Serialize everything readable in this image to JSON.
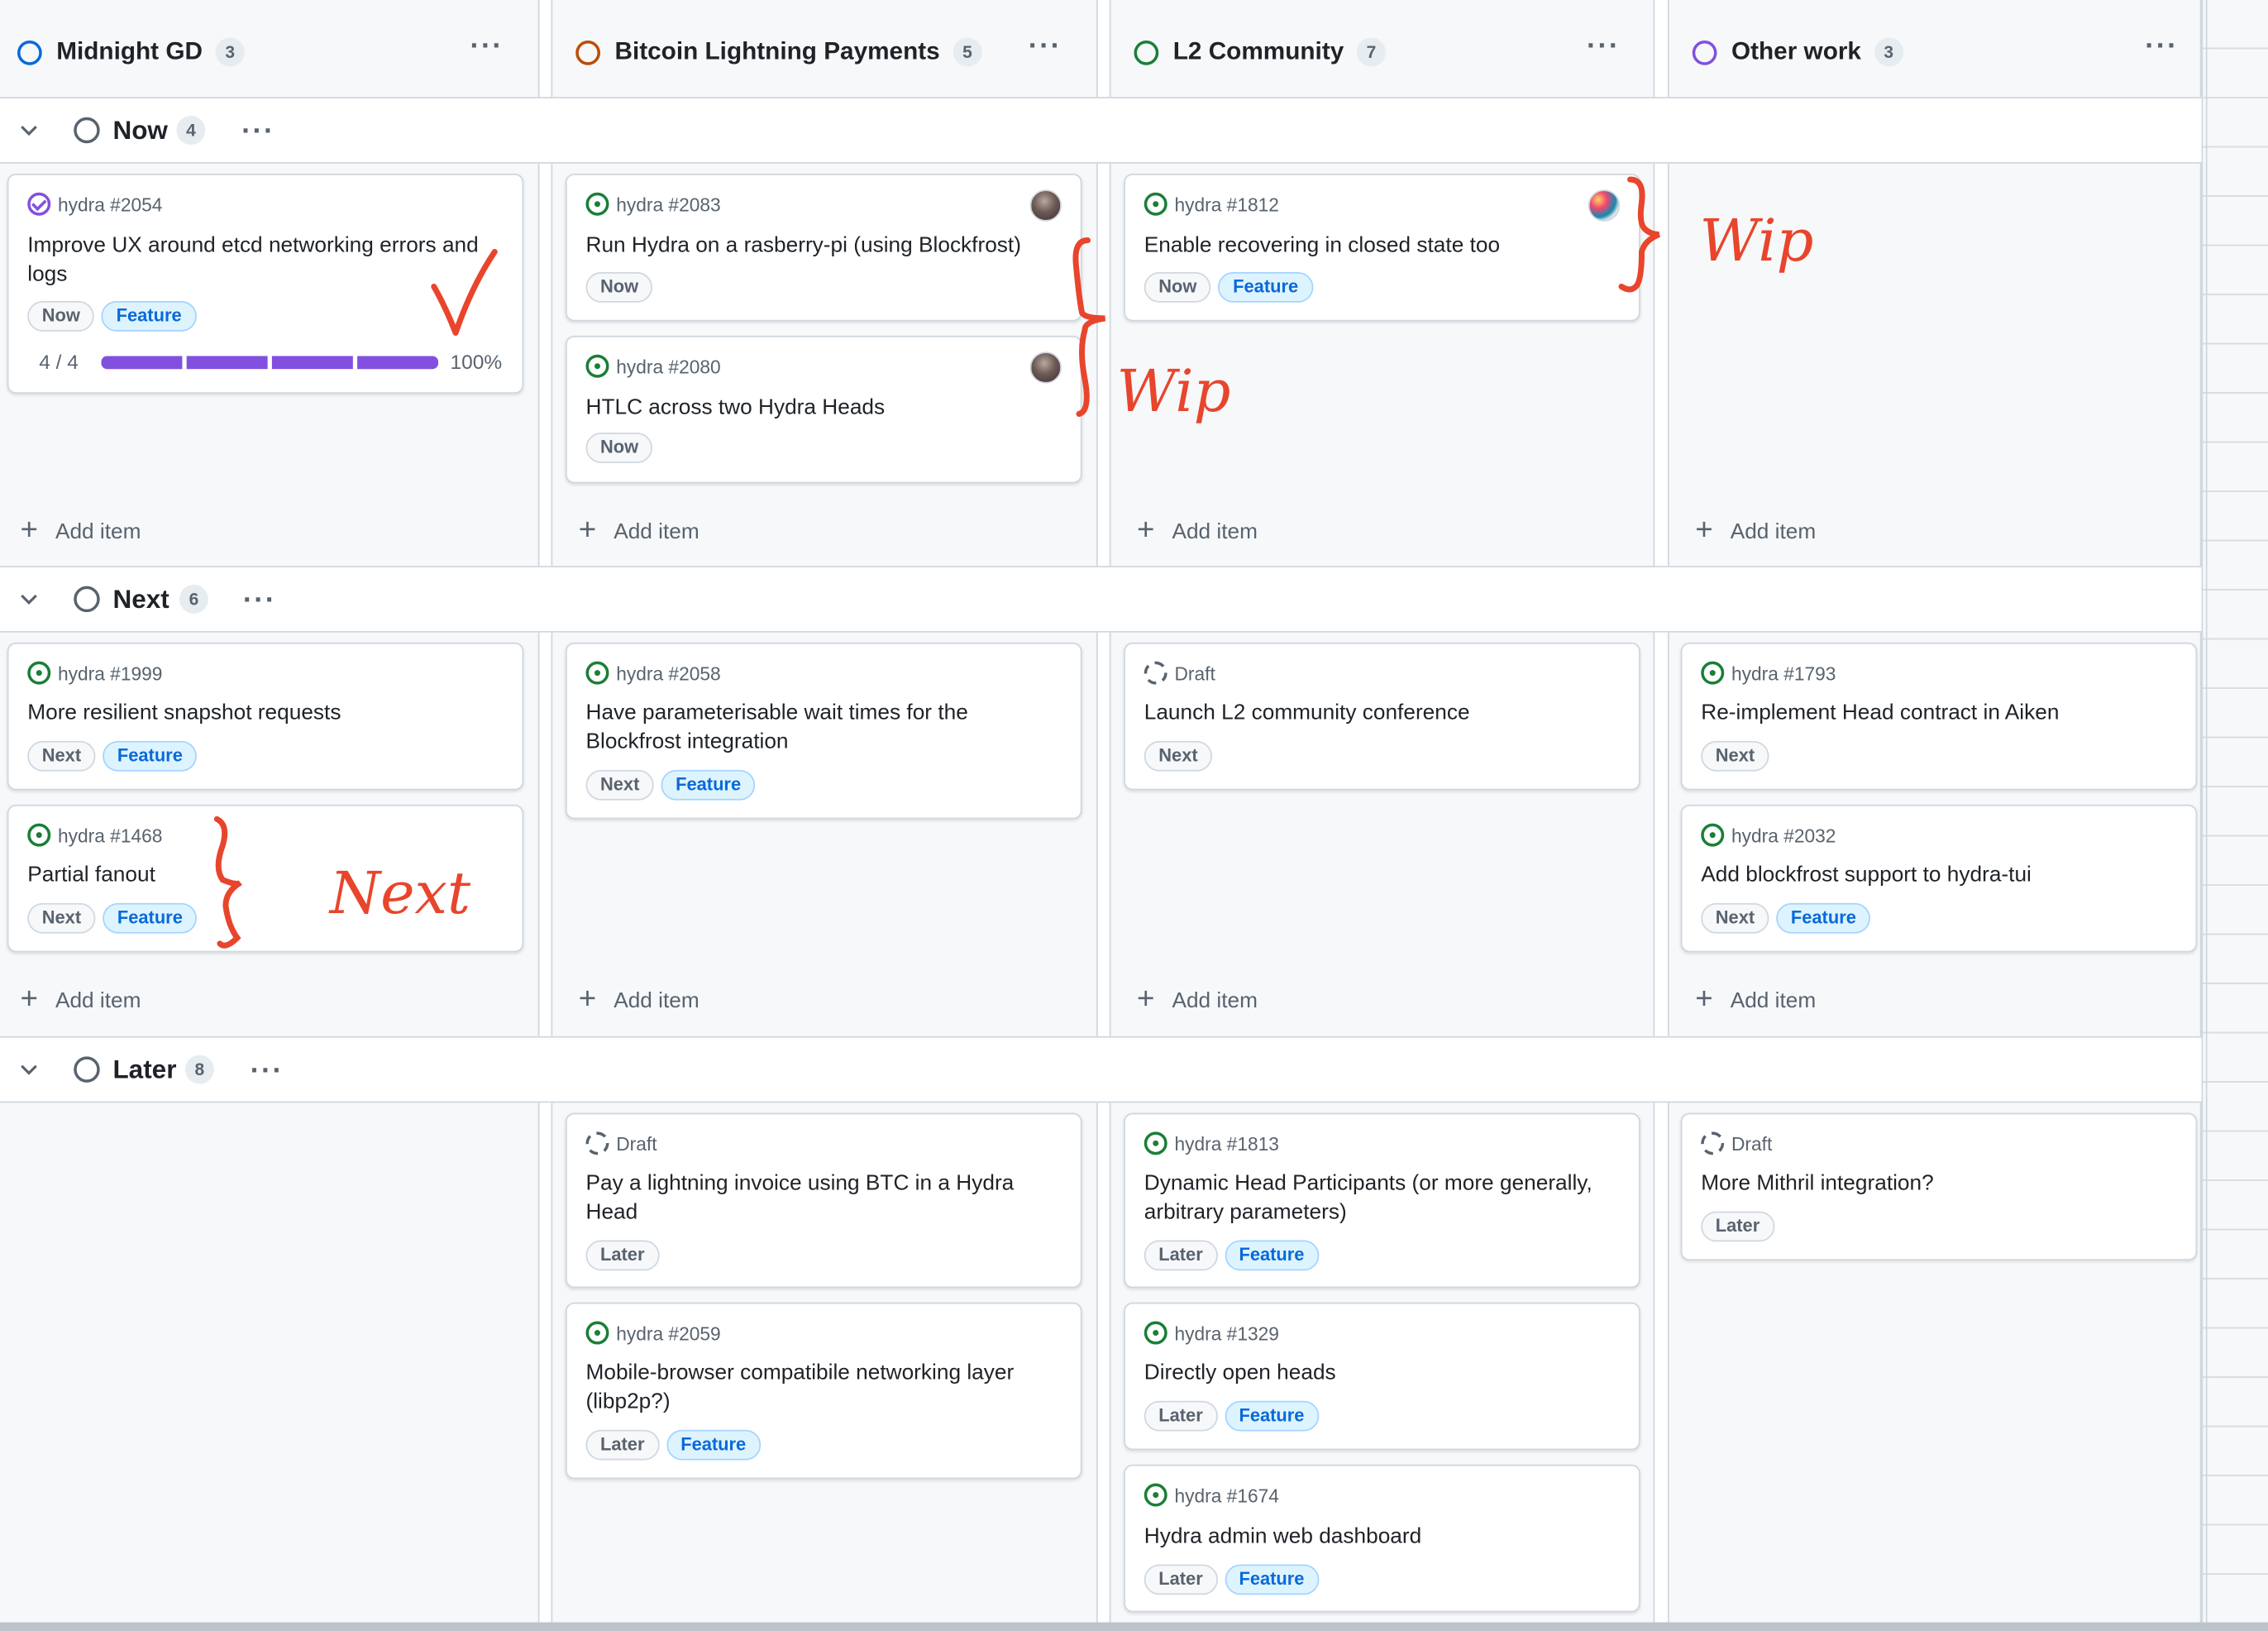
{
  "columns": [
    {
      "title": "Midnight GD",
      "count": "3",
      "color": "#0969da"
    },
    {
      "title": "Bitcoin Lightning Payments",
      "count": "5",
      "color": "#bc4c00"
    },
    {
      "title": "L2 Community",
      "count": "7",
      "color": "#1a7f37"
    },
    {
      "title": "Other work",
      "count": "3",
      "color": "#8250df"
    }
  ],
  "more_icon": "···",
  "groups": {
    "now": {
      "title": "Now",
      "count": "4"
    },
    "next": {
      "title": "Next",
      "count": "6"
    },
    "later": {
      "title": "Later",
      "count": "8"
    }
  },
  "add_item_label": "Add item",
  "cards": {
    "c2054": {
      "ref": "hydra #2054",
      "title": "Improve UX around etcd networking errors and logs",
      "labels": [
        "Now",
        "Feature"
      ],
      "progress": {
        "text": "4 / 4",
        "percent": "100%",
        "value": 1.0
      }
    },
    "c2083": {
      "ref": "hydra #2083",
      "title": "Run Hydra on a rasberry-pi (using Blockfrost)",
      "labels": [
        "Now"
      ]
    },
    "c2080": {
      "ref": "hydra #2080",
      "title": "HTLC across two Hydra Heads",
      "labels": [
        "Now"
      ]
    },
    "c1812": {
      "ref": "hydra #1812",
      "title": "Enable recovering in closed state too",
      "labels": [
        "Now",
        "Feature"
      ]
    },
    "c1999": {
      "ref": "hydra #1999",
      "title": "More resilient snapshot requests",
      "labels": [
        "Next",
        "Feature"
      ]
    },
    "c1468": {
      "ref": "hydra #1468",
      "title": "Partial fanout",
      "labels": [
        "Next",
        "Feature"
      ]
    },
    "c2058": {
      "ref": "hydra #2058",
      "title": "Have parameterisable wait times for the Blockfrost integration",
      "labels": [
        "Next",
        "Feature"
      ]
    },
    "draft_conf": {
      "ref": "Draft",
      "title": "Launch L2 community conference",
      "labels": [
        "Next"
      ]
    },
    "c1793": {
      "ref": "hydra #1793",
      "title": "Re-implement Head contract in Aiken",
      "labels": [
        "Next"
      ]
    },
    "c2032": {
      "ref": "hydra #2032",
      "title": "Add blockfrost support to hydra-tui",
      "labels": [
        "Next",
        "Feature"
      ]
    },
    "draft_ln": {
      "ref": "Draft",
      "title": "Pay a lightning invoice using BTC in a Hydra Head",
      "labels": [
        "Later"
      ]
    },
    "c2059": {
      "ref": "hydra #2059",
      "title": "Mobile-browser compatibile networking layer (libp2p?)",
      "labels": [
        "Later",
        "Feature"
      ]
    },
    "c1813": {
      "ref": "hydra #1813",
      "title": "Dynamic Head Participants (or more generally, arbitrary parameters)",
      "labels": [
        "Later",
        "Feature"
      ]
    },
    "c1329": {
      "ref": "hydra #1329",
      "title": "Directly open heads",
      "labels": [
        "Later",
        "Feature"
      ]
    },
    "c1674": {
      "ref": "hydra #1674",
      "title": "Hydra admin web dashboard",
      "labels": [
        "Later",
        "Feature"
      ]
    },
    "draft_mithril": {
      "ref": "Draft",
      "title": "More Mithril integration?",
      "labels": [
        "Later"
      ]
    }
  },
  "annotations": {
    "wip": "Wip",
    "next": "Next",
    "accent": "#e8452c"
  }
}
